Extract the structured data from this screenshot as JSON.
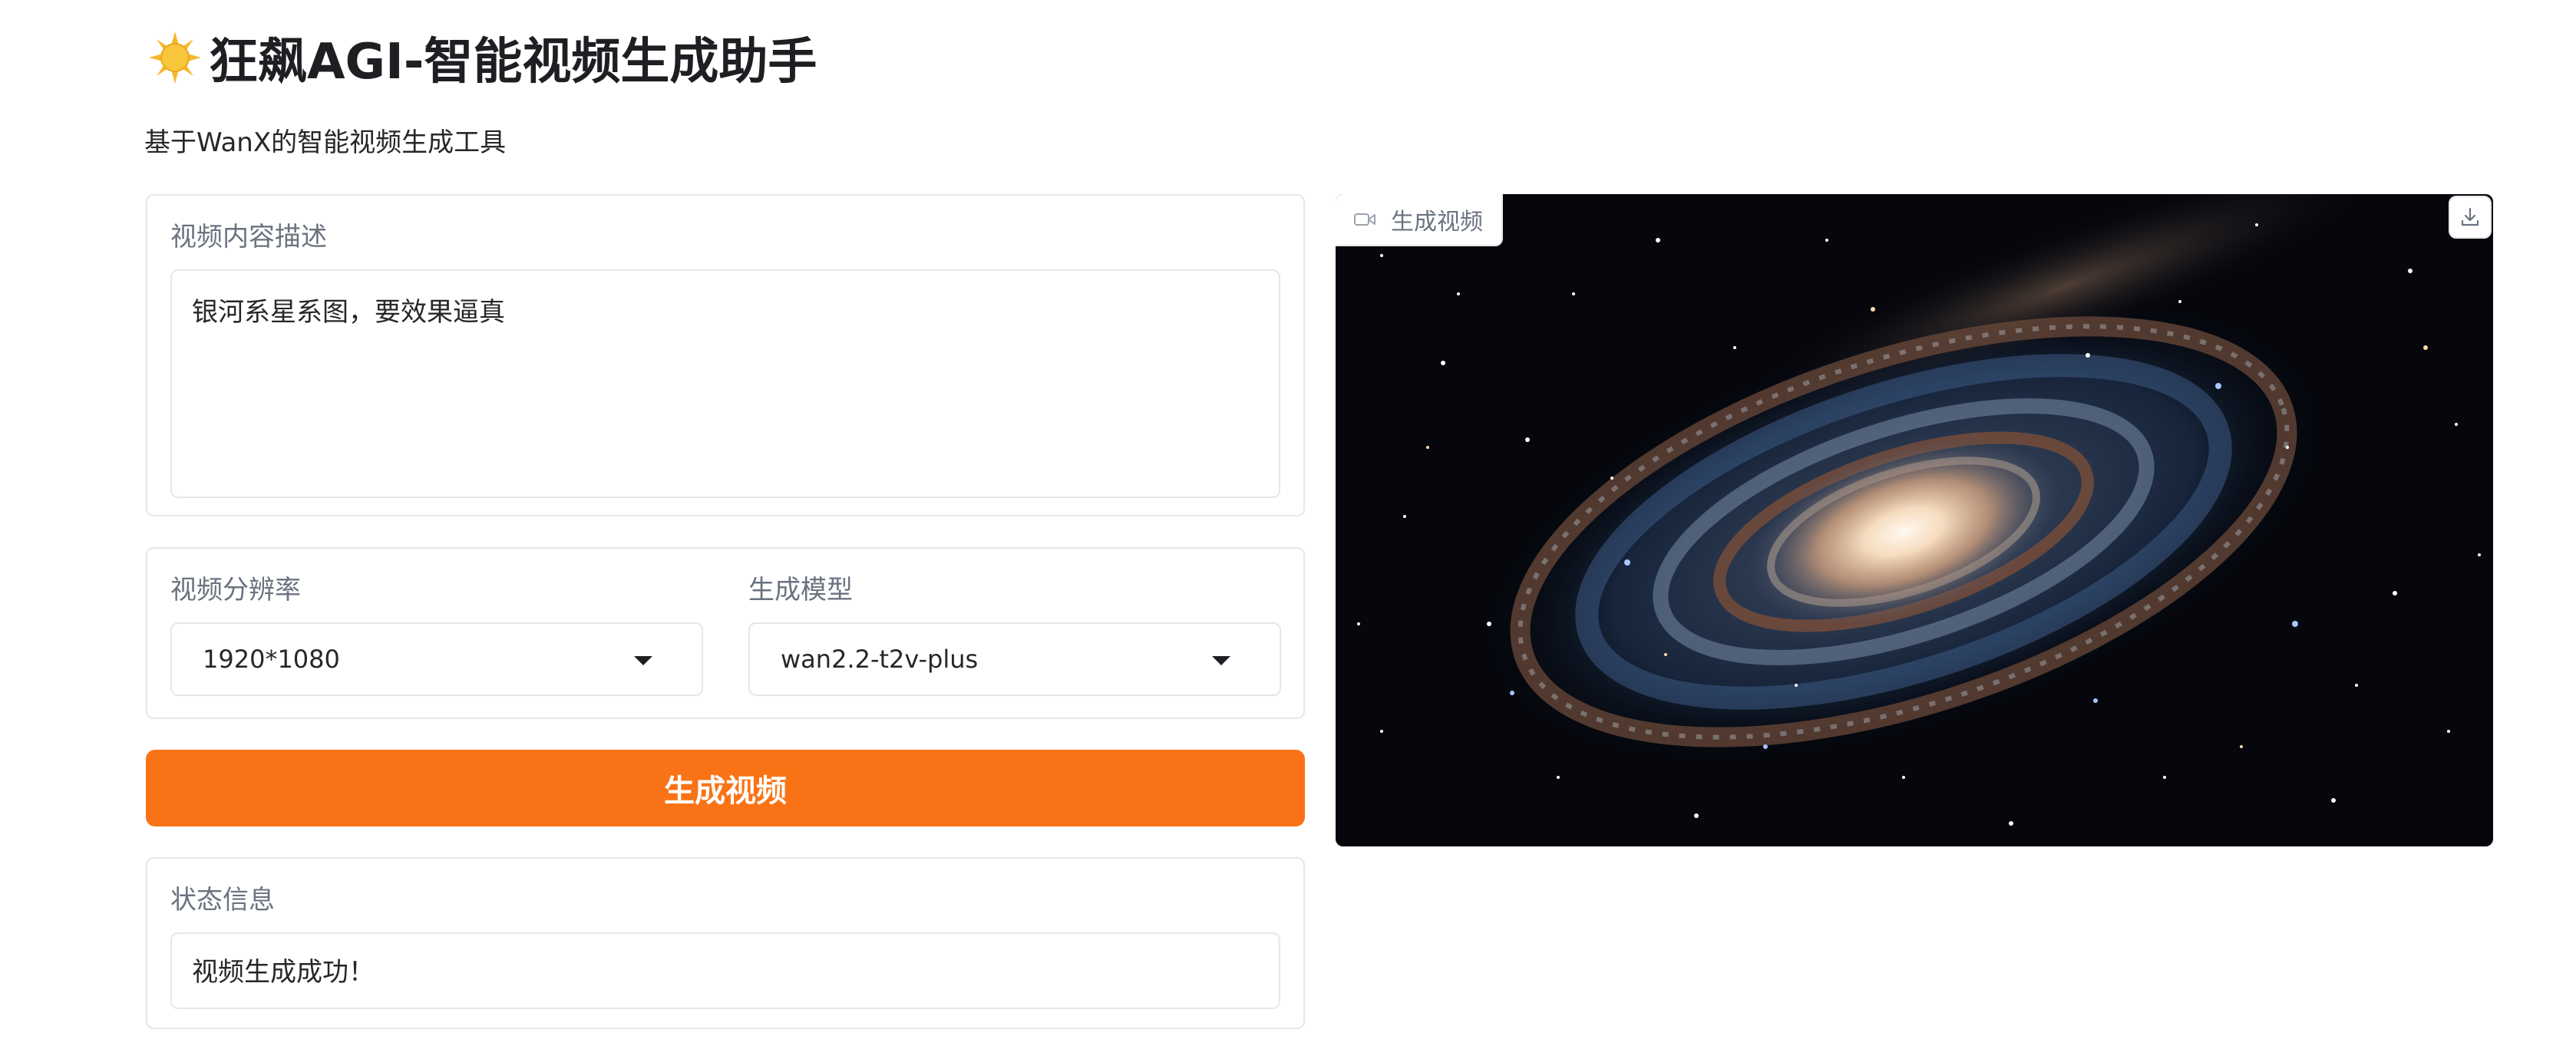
{
  "header": {
    "title": "狂飙AGI-智能视频生成助手",
    "subtitle": "基于WanX的智能视频生成工具",
    "logo_icon": "sun-emoji-icon"
  },
  "prompt_card": {
    "label": "视频内容描述",
    "value": "银河系星系图，要效果逼真"
  },
  "settings_card": {
    "resolution": {
      "label": "视频分辨率",
      "value": "1920*1080"
    },
    "model": {
      "label": "生成模型",
      "value": "wan2.2-t2v-plus"
    }
  },
  "generate_button": {
    "label": "生成视频",
    "color": "#f97316"
  },
  "status_card": {
    "label": "状态信息",
    "value": "视频生成成功！"
  },
  "video_panel": {
    "tag_label": "生成视频",
    "tag_icon": "video-camera-icon",
    "download_icon": "download-icon"
  }
}
